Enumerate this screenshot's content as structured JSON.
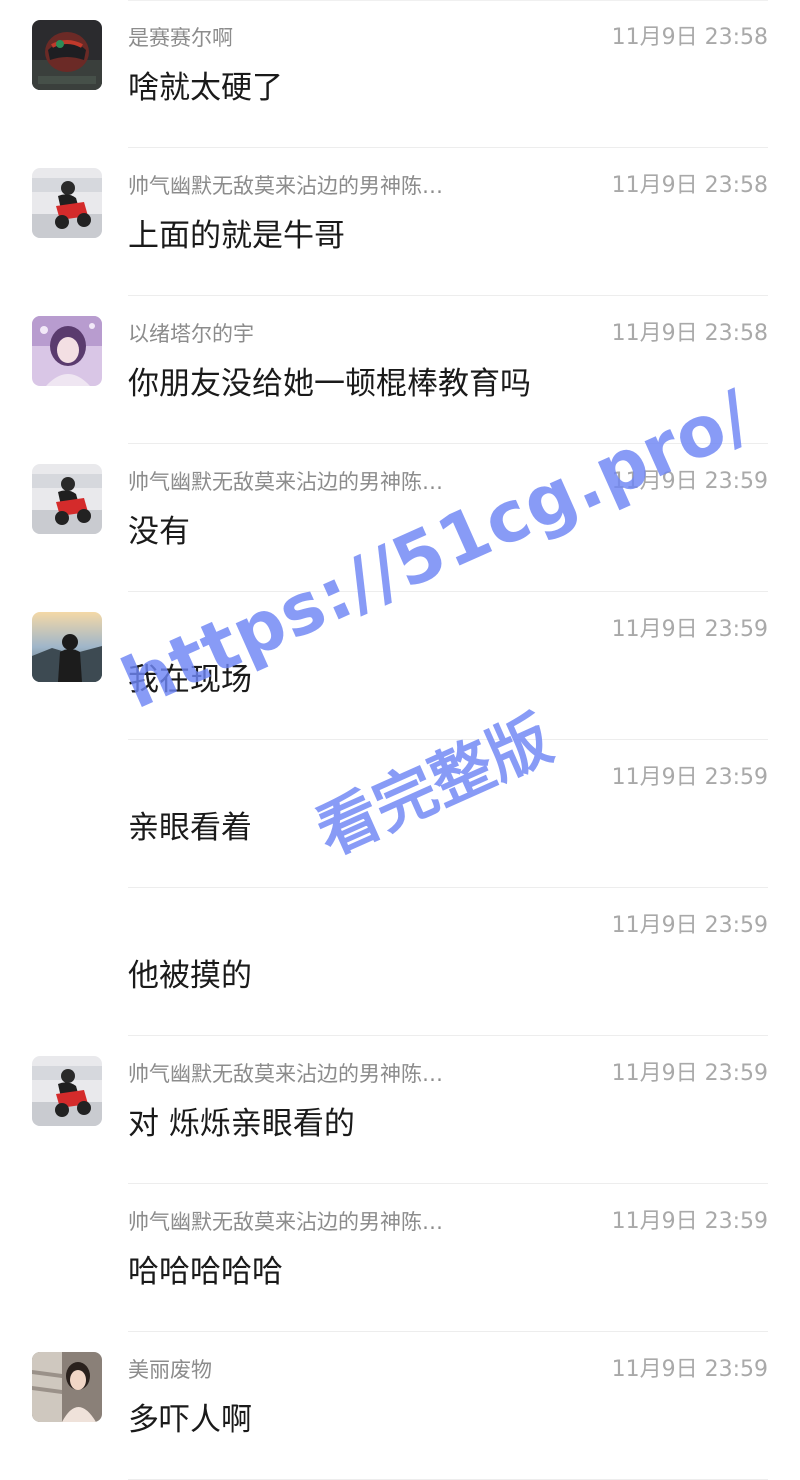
{
  "messages": [
    {
      "sender": "是赛赛尔啊",
      "time": "11月9日 23:58",
      "text": "啥就太硬了",
      "avatar": "helmet-avatar"
    },
    {
      "sender": "帅气幽默无敌莫来沾边的男神陈…",
      "time": "11月9日 23:58",
      "text": "上面的就是牛哥",
      "avatar": "motorcycle-avatar"
    },
    {
      "sender": "以绪塔尔的宇",
      "time": "11月9日 23:58",
      "text": "你朋友没给她一顿棍棒教育吗",
      "avatar": "anime-girl-avatar"
    },
    {
      "sender": "帅气幽默无敌莫来沾边的男神陈…",
      "time": "11月9日 23:59",
      "text": "没有",
      "avatar": "motorcycle-avatar"
    },
    {
      "sender": "",
      "time": "11月9日 23:59",
      "text": "我在现场",
      "avatar": "rider-sunset-avatar"
    },
    {
      "sender": "",
      "time": "11月9日 23:59",
      "text": "亲眼看着",
      "avatar": ""
    },
    {
      "sender": "",
      "time": "11月9日 23:59",
      "text": "他被摸的",
      "avatar": ""
    },
    {
      "sender": "帅气幽默无敌莫来沾边的男神陈…",
      "time": "11月9日 23:59",
      "text": "对 烁烁亲眼看的",
      "avatar": "motorcycle-avatar"
    },
    {
      "sender": "帅气幽默无敌莫来沾边的男神陈…",
      "time": "11月9日 23:59",
      "text": "哈哈哈哈哈",
      "avatar": ""
    },
    {
      "sender": "美丽废物",
      "time": "11月9日 23:59",
      "text": "多吓人啊",
      "avatar": "girl-photo-avatar"
    }
  ],
  "watermark": {
    "line1": "https://51cg.pro/",
    "line2": "看完整版",
    "color": "#6f86f5"
  },
  "colors": {
    "sender": "#8c8c8c",
    "time": "#a9a9a9",
    "text": "#1a1a1a",
    "divider": "#ededed"
  }
}
